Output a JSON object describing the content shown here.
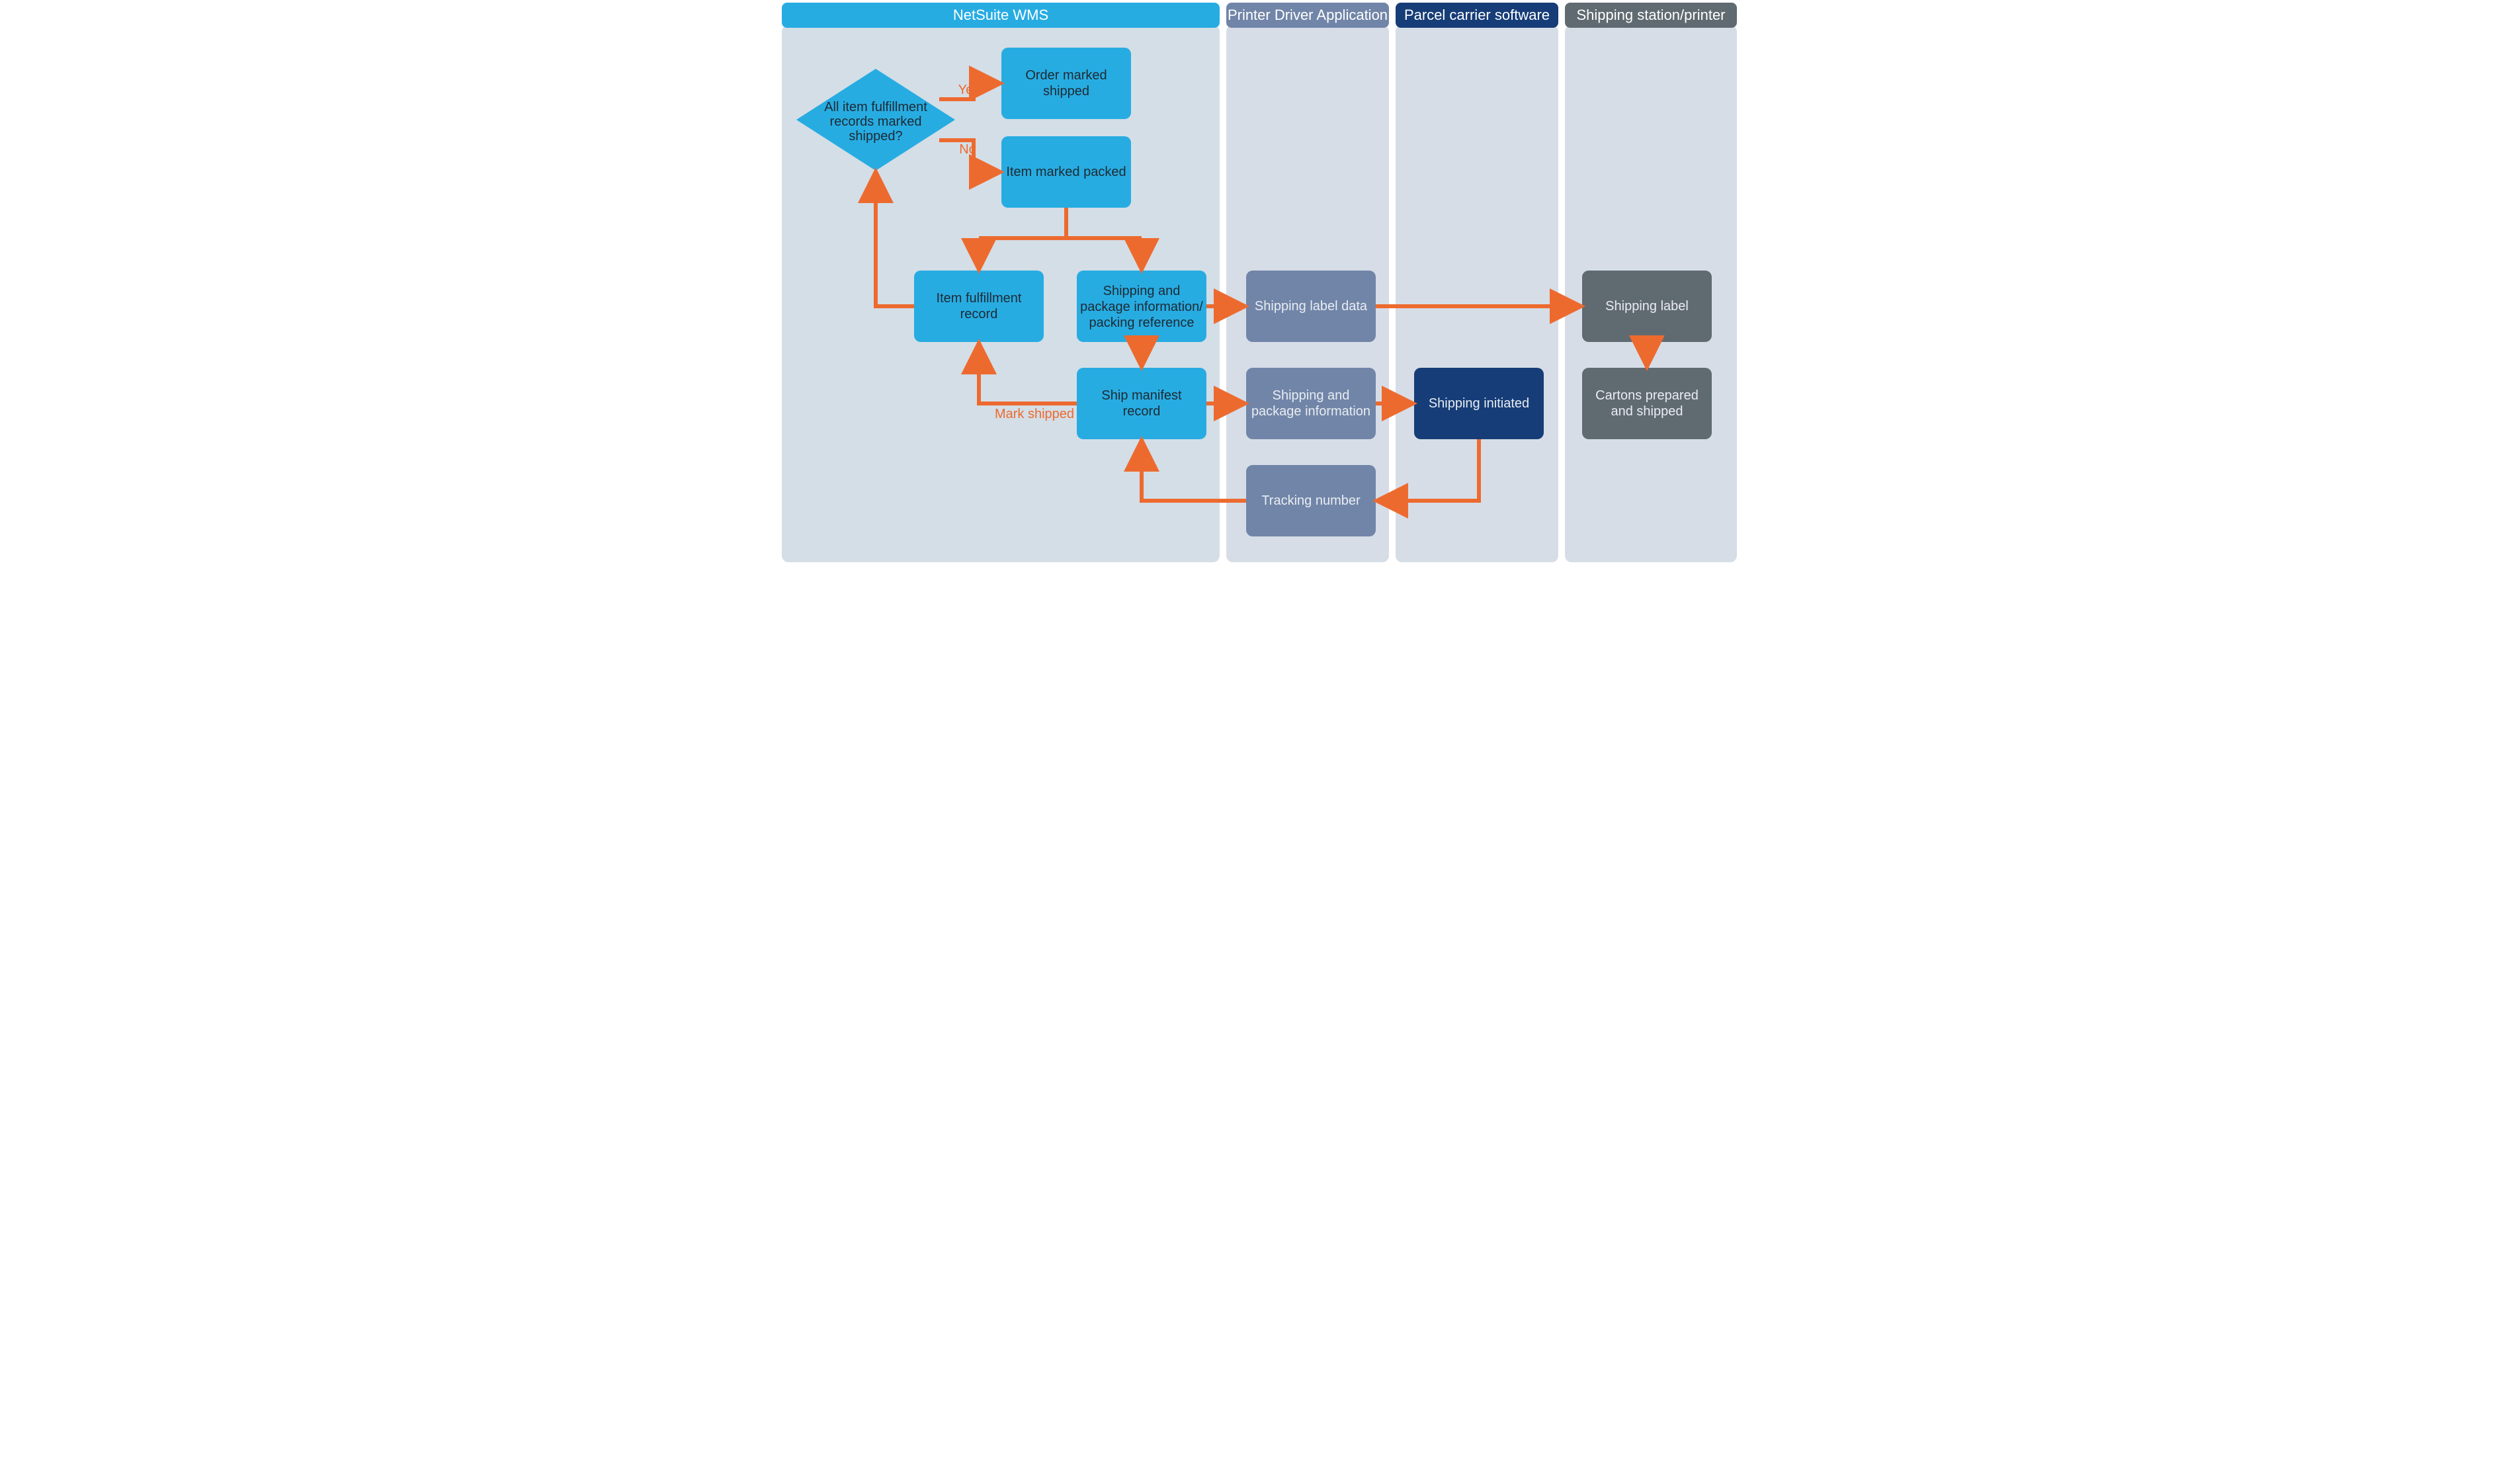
{
  "lanes": {
    "wms": {
      "header": "NetSuite WMS"
    },
    "printer": {
      "header": "Printer Driver Application"
    },
    "carrier": {
      "header": "Parcel carrier software"
    },
    "station": {
      "header": "Shipping station/printer"
    }
  },
  "nodes": {
    "decision": {
      "l1": "All item fulfillment",
      "l2": "records marked",
      "l3": "shipped?"
    },
    "order_shipped": {
      "l1": "Order marked",
      "l2": "shipped"
    },
    "item_packed": {
      "l1": "Item marked packed"
    },
    "fulfillment": {
      "l1": "Item fulfillment",
      "l2": "record"
    },
    "ship_pkg_ref": {
      "l1": "Shipping and",
      "l2": "package information/",
      "l3": "packing reference"
    },
    "ship_manifest": {
      "l1": "Ship manifest",
      "l2": "record"
    },
    "label_data": {
      "l1": "Shipping label data"
    },
    "ship_pkg_info": {
      "l1": "Shipping and",
      "l2": "package information"
    },
    "tracking": {
      "l1": "Tracking number"
    },
    "ship_init": {
      "l1": "Shipping initiated"
    },
    "ship_label": {
      "l1": "Shipping label"
    },
    "cartons": {
      "l1": "Cartons prepared",
      "l2": "and shipped"
    }
  },
  "edges": {
    "yes": {
      "label": "Yes"
    },
    "no": {
      "label": "No"
    },
    "mark_shipped": {
      "label": "Mark shipped"
    }
  },
  "colors": {
    "wms_header": "#27ace2",
    "wms_box": "#27ace2",
    "wms_bg": "#d4dee6",
    "printer_header": "#7185a8",
    "printer_box": "#7185a8",
    "printer_bg": "#d6dde7",
    "carrier_header": "#163d77",
    "carrier_box": "#163d77",
    "carrier_bg": "#d6dde7",
    "station_header": "#606a71",
    "station_box": "#606a71",
    "station_bg": "#d6dde7",
    "arrow": "#ed6a2f"
  }
}
